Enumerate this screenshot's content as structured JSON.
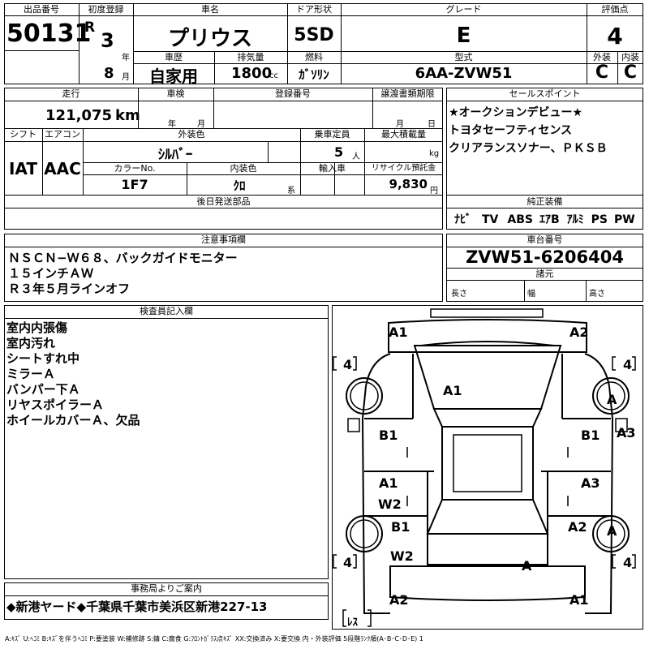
{
  "labels": {
    "lot_no": "出品番号",
    "first_reg": "初度登録",
    "car_name": "車名",
    "door": "ドア形状",
    "grade": "グレード",
    "score": "評価点",
    "history": "車歴",
    "displacement": "排気量",
    "fuel": "燃料",
    "model": "型式",
    "exterior": "外装",
    "interior": "内装",
    "mileage": "走行",
    "inspection": "車検",
    "reg_no": "登録番号",
    "transfer": "譲渡書類期限",
    "sales_point": "セールスポイント",
    "shift": "シフト",
    "aircon": "エアコン",
    "ext_color": "外装色",
    "capacity": "乗車定員",
    "max_load": "最大積載量",
    "color_no": "カラーNo.",
    "int_color": "内装色",
    "import": "輸入車",
    "recycle": "リサイクル預託金",
    "later_parts": "後日発送部品",
    "genuine": "純正装備",
    "notes": "注意事項欄",
    "chassis": "車台番号",
    "specs": "諸元",
    "inspector": "検査員記入欄",
    "office": "事務局よりご案内"
  },
  "vehicle": {
    "lot_no": "50131",
    "era": "R",
    "year": "3",
    "year_unit": "年",
    "month": "8",
    "month_unit": "月",
    "name": "プリウス",
    "door": "5SD",
    "grade": "E",
    "score": "4",
    "history": "自家用",
    "displacement": "1800",
    "displacement_unit": "cc",
    "fuel": "ｶﾞｿﾘﾝ",
    "model": "6AA-ZVW51",
    "exterior_grade": "C",
    "interior_grade": "C",
    "mileage": "121,075",
    "mileage_unit": "km",
    "inspection_year": "年",
    "inspection_month": "月",
    "transfer_month": "月",
    "transfer_day": "日",
    "shift": "IAT",
    "aircon": "AAC",
    "ext_color": "ｼﾙﾊﾞｰ",
    "capacity": "5",
    "capacity_unit": "人",
    "load_unit": "kg",
    "color_no": "1F7",
    "int_color": "ｸﾛ",
    "int_color_suffix": "系",
    "recycle": "9,830",
    "recycle_unit": "円",
    "chassis": "ZVW51-6206404",
    "spec_length": "長さ",
    "spec_width": "幅",
    "spec_height": "高さ"
  },
  "sales_points": [
    "★オークションデビュー★",
    "トヨタセーフティセンス",
    "クリアランスソナー、ＰＫＳＢ"
  ],
  "equipment": [
    "ﾅﾋﾞ",
    "TV",
    "ABS",
    "ｴｱB",
    "ｱﾙﾐ",
    "PS",
    "PW"
  ],
  "notes": [
    "ＮＳＣＮ−Ｗ６８、バックガイドモニター",
    "１５インチＡＷ",
    "Ｒ３年５月ラインオフ"
  ],
  "inspector_notes": [
    "室内内張傷",
    "室内汚れ",
    "シートすれ中",
    "ミラーＡ",
    "バンパー下Ａ",
    "リヤスポイラーＡ",
    "ホイールカバーＡ、欠品"
  ],
  "office_note": "◆新港ヤード◆千葉県千葉市美浜区新港227-13",
  "diagram": {
    "tires": [
      "4",
      "4",
      "4",
      "4"
    ],
    "marks": {
      "front_left": "A1",
      "front_right": "A2",
      "hood": "A1",
      "wheel_fr": "A",
      "front_fender_right": "A3",
      "front_door_left": "B1",
      "front_door_right": "B1",
      "rear_door_left_top": "A1",
      "rear_door_left_bottom": "W2",
      "rear_door_right": "A3",
      "rear_fender_left": "B1",
      "rear_fender_right": "A2",
      "rear_left_low": "W2",
      "wheel_rr": "A",
      "rear_center": "A",
      "rear_bumper_left": "A2",
      "rear_bumper_right": "A1",
      "spare": "ﾚｽ"
    }
  },
  "legend": "A:ｷｽﾞ U:ﾍｺﾐ B:ｷｽﾞを伴うﾍｺﾐ P:要塗装 W:補修跡 S:錆 C:腐食 G:ﾌﾛﾝﾄｶﾞﾗｽ点ｷｽﾞ XX:交換済み X:要交換 内・外装評価 5段階ﾗﾝｸ順(A･B･C･D･E) 1"
}
